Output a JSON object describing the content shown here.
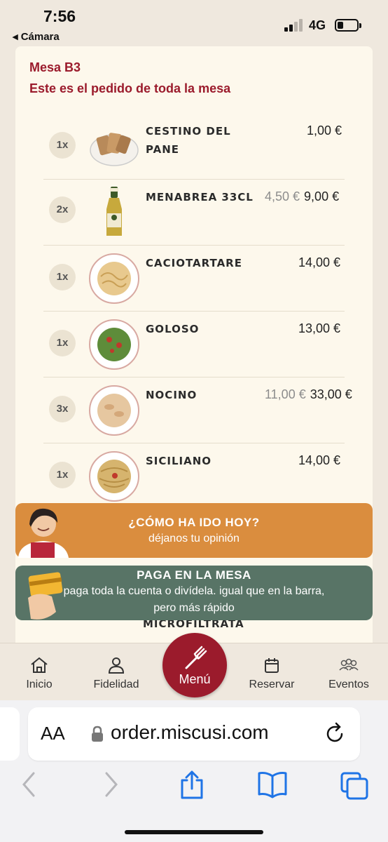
{
  "status_bar": {
    "time": "7:56",
    "back_label": "◂ Cámara",
    "network": "4G"
  },
  "order": {
    "table": "Mesa B3",
    "subtitle": "Este es el pedido de toda la mesa",
    "items": [
      {
        "qty": "1x",
        "name": "CESTINO DEL PANE",
        "unit_price": "",
        "total": "1,00 €"
      },
      {
        "qty": "2x",
        "name": "MENABREA 33CL",
        "unit_price": "4,50 €",
        "total": "9,00 €"
      },
      {
        "qty": "1x",
        "name": "CACIOTARTARE",
        "unit_price": "",
        "total": "14,00 €"
      },
      {
        "qty": "1x",
        "name": "GOLOSO",
        "unit_price": "",
        "total": "13,00 €"
      },
      {
        "qty": "3x",
        "name": "NOCINO",
        "unit_price": "11,00 €",
        "total": "33,00 €"
      },
      {
        "qty": "1x",
        "name": "SICILIANO",
        "unit_price": "",
        "total": "14,00 €"
      }
    ],
    "partial_item_name": "MICROFILTRATA"
  },
  "banners": {
    "opinion": {
      "title": "¿CÓMO HA IDO HOY?",
      "subtitle": "déjanos tu opinión",
      "color": "#da8d3e"
    },
    "pay": {
      "title": "PAGA EN LA MESA",
      "subtitle_line1": "paga toda la cuenta o divídela. igual que en la barra,",
      "subtitle_line2": "pero más rápido",
      "color": "#587466"
    }
  },
  "nav": {
    "inicio": "Inicio",
    "fidelidad": "Fidelidad",
    "menu": "Menú",
    "reservar": "Reservar",
    "eventos": "Eventos",
    "accent": "#9b1b2c"
  },
  "browser": {
    "aa_label": "AA",
    "url": "order.miscusi.com"
  }
}
